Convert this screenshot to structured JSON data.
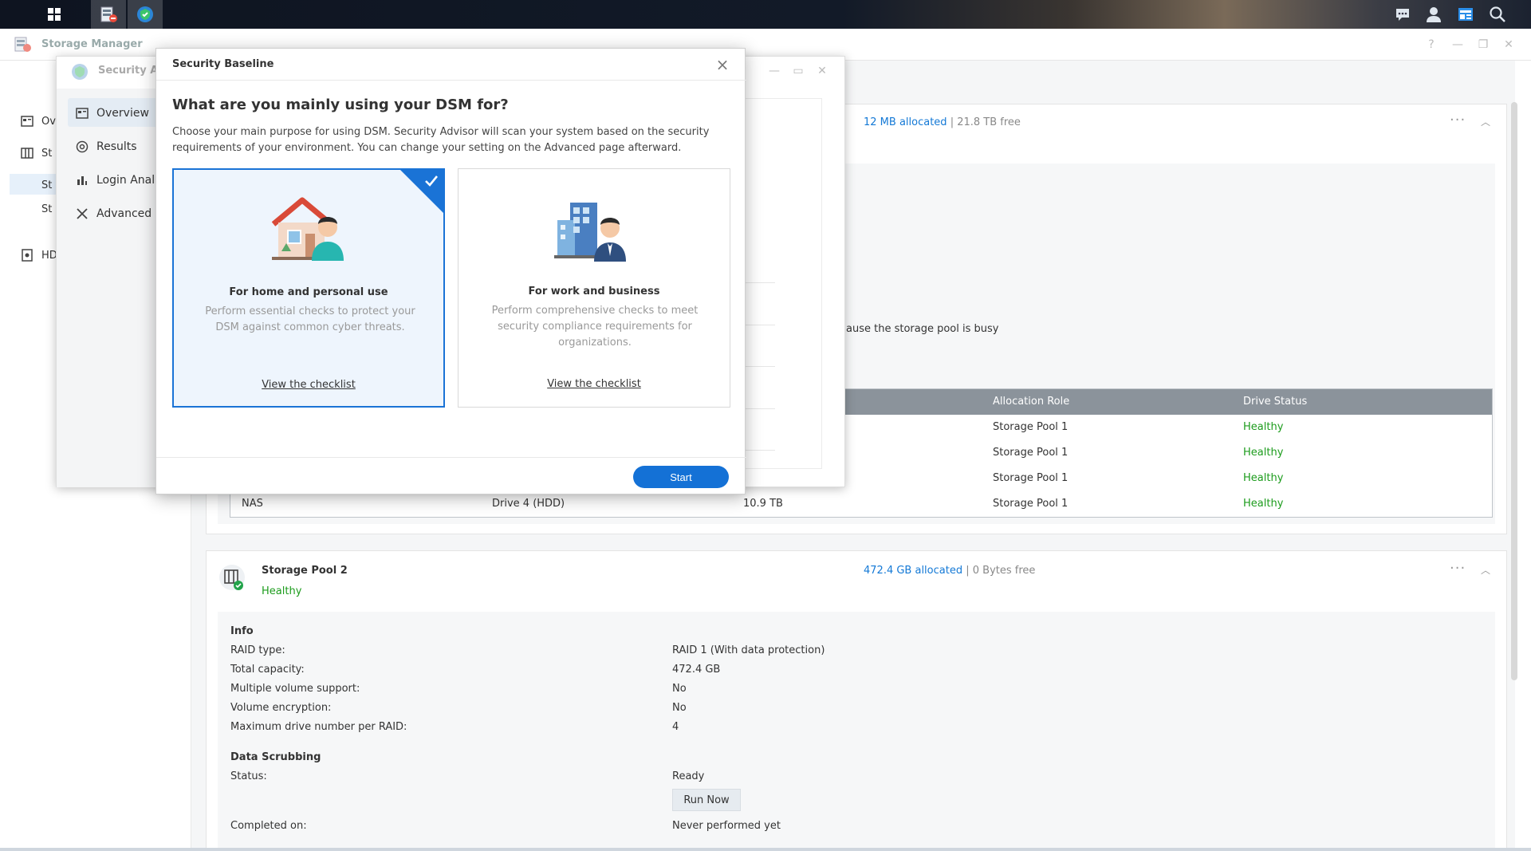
{
  "storage_manager": {
    "title": "Storage Manager",
    "sidebar": [
      {
        "label": "Ov"
      },
      {
        "label": "St"
      },
      {
        "label": "St"
      },
      {
        "label": "St"
      },
      {
        "label": "HD"
      }
    ],
    "pool1": {
      "allocated": "12 MB allocated",
      "sep": "|",
      "free": "21.8 TB free",
      "busy_msg": "ause the storage pool is busy",
      "table": {
        "headers": [
          "Allocation Role",
          "Drive Status"
        ],
        "rows": [
          {
            "name": "",
            "drive": "",
            "size": "",
            "role": "Storage Pool 1",
            "status": "Healthy"
          },
          {
            "name": "",
            "drive": "",
            "size": "",
            "role": "Storage Pool 1",
            "status": "Healthy"
          },
          {
            "name": "",
            "drive": "",
            "size": "",
            "role": "Storage Pool 1",
            "status": "Healthy"
          },
          {
            "name": "NAS",
            "drive": "Drive 4 (HDD)",
            "size": "10.9 TB",
            "role": "Storage Pool 1",
            "status": "Healthy"
          }
        ]
      }
    },
    "pool2": {
      "name": "Storage Pool 2",
      "status": "Healthy",
      "allocated": "472.4 GB allocated",
      "sep": "|",
      "free": "0 Bytes free",
      "info_heading": "Info",
      "info": [
        {
          "label": "RAID type:",
          "value": "RAID 1 (With data protection)"
        },
        {
          "label": "Total capacity:",
          "value": "472.4 GB"
        },
        {
          "label": "Multiple volume support:",
          "value": "No"
        },
        {
          "label": "Volume encryption:",
          "value": "No"
        },
        {
          "label": "Maximum drive number per RAID:",
          "value": "4"
        }
      ],
      "scrub_heading": "Data Scrubbing",
      "scrub_status_label": "Status:",
      "scrub_status_value": "Ready",
      "run_now": "Run Now",
      "completed_label": "Completed on:",
      "completed_value": "Never performed yet"
    }
  },
  "security_advisor": {
    "title": "Security Ad",
    "sidebar": [
      {
        "label": "Overview"
      },
      {
        "label": "Results"
      },
      {
        "label": "Login Anal"
      },
      {
        "label": "Advanced"
      }
    ]
  },
  "modal": {
    "title": "Security Baseline",
    "heading": "What are you mainly using your DSM for?",
    "description": "Choose your main purpose for using DSM. Security Advisor will scan your system based on the security requirements of your environment. You can change your setting on the Advanced page afterward.",
    "options": [
      {
        "title": "For home and personal use",
        "desc": "Perform essential checks to protect your DSM against common cyber threats.",
        "link": "View the checklist",
        "selected": true
      },
      {
        "title": "For work and business",
        "desc": "Perform comprehensive checks to meet security compliance requirements for organizations.",
        "link": "View the checklist",
        "selected": false
      }
    ],
    "start_label": "Start"
  },
  "icons": {
    "taskbar": [
      "grid-icon",
      "storage-manager-icon",
      "security-advisor-icon",
      "chat-icon",
      "user-icon",
      "widgets-icon",
      "search-icon"
    ]
  },
  "colors": {
    "accent": "#1471d6",
    "healthy": "#1c9c1c",
    "link": "#1479d6"
  }
}
